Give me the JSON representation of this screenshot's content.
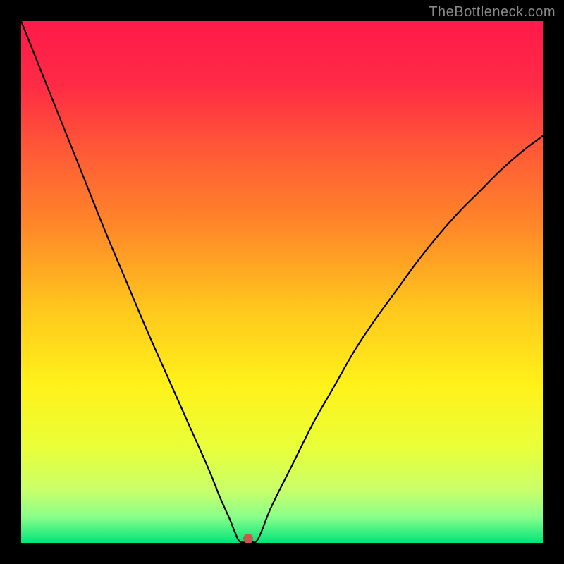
{
  "watermark": "TheBottleneck.com",
  "chart_data": {
    "type": "line",
    "title": "",
    "xlabel": "",
    "ylabel": "",
    "xlim": [
      0,
      100
    ],
    "ylim": [
      0,
      100
    ],
    "grid": false,
    "legend": false,
    "background_gradient": {
      "stops": [
        {
          "pos": 0.0,
          "color": "#ff1a4a"
        },
        {
          "pos": 0.12,
          "color": "#ff2a45"
        },
        {
          "pos": 0.25,
          "color": "#ff5a36"
        },
        {
          "pos": 0.4,
          "color": "#ff8a28"
        },
        {
          "pos": 0.55,
          "color": "#ffc71d"
        },
        {
          "pos": 0.7,
          "color": "#fff21a"
        },
        {
          "pos": 0.82,
          "color": "#e8ff3a"
        },
        {
          "pos": 0.9,
          "color": "#c8ff6a"
        },
        {
          "pos": 0.95,
          "color": "#8aff8a"
        },
        {
          "pos": 1.0,
          "color": "#00e57a"
        }
      ]
    },
    "series": [
      {
        "name": "bottleneck-curve",
        "color": "#000000",
        "x": [
          0,
          4,
          8,
          12,
          16,
          20,
          24,
          28,
          32,
          36,
          38,
          40,
          41,
          42,
          44,
          45,
          46,
          48,
          52,
          56,
          60,
          64,
          68,
          72,
          76,
          80,
          84,
          88,
          92,
          96,
          100
        ],
        "y": [
          100,
          90,
          80,
          70,
          60,
          50.5,
          41,
          32,
          23,
          14,
          9,
          4.5,
          2,
          0.2,
          0.2,
          0.2,
          2,
          7,
          15,
          23,
          30,
          37,
          43,
          48.5,
          54,
          59,
          63.5,
          67.5,
          71.5,
          75,
          78
        ]
      }
    ],
    "marker": {
      "name": "optimal-point",
      "x": 43.5,
      "y": 0.8,
      "color": "#c45a4a"
    }
  }
}
